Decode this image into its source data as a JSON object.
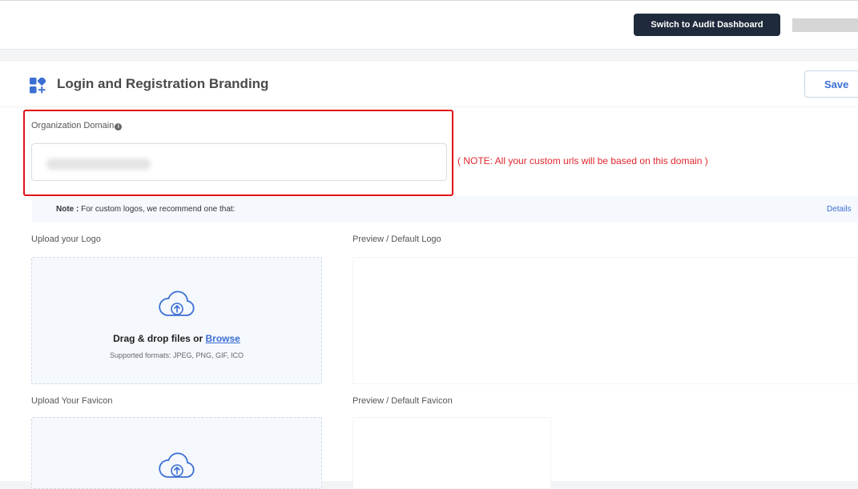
{
  "topbar": {
    "switch_button": "Switch to Audit Dashboard"
  },
  "header": {
    "title": "Login and Registration Branding",
    "save_label": "Save"
  },
  "domain": {
    "label": "Organization Domain",
    "info_icon": "info-icon",
    "note": "( NOTE: All your custom urls will be based on this domain )"
  },
  "note_bar": {
    "prefix": "Note :",
    "text": " For custom logos, we recommend one that:",
    "details": "Details"
  },
  "logo": {
    "upload_label": "Upload your Logo",
    "preview_label": "Preview / Default Logo",
    "drop_text": "Drag & drop files or ",
    "browse": "Browse",
    "formats": "Supported formats: JPEG, PNG, GIF, ICO"
  },
  "favicon": {
    "upload_label": "Upload Your Favicon",
    "preview_label": "Preview / Default Favicon"
  },
  "colors": {
    "accent": "#3b6fd4",
    "dark_button": "#1f2a3c",
    "highlight": "#e0121a"
  }
}
